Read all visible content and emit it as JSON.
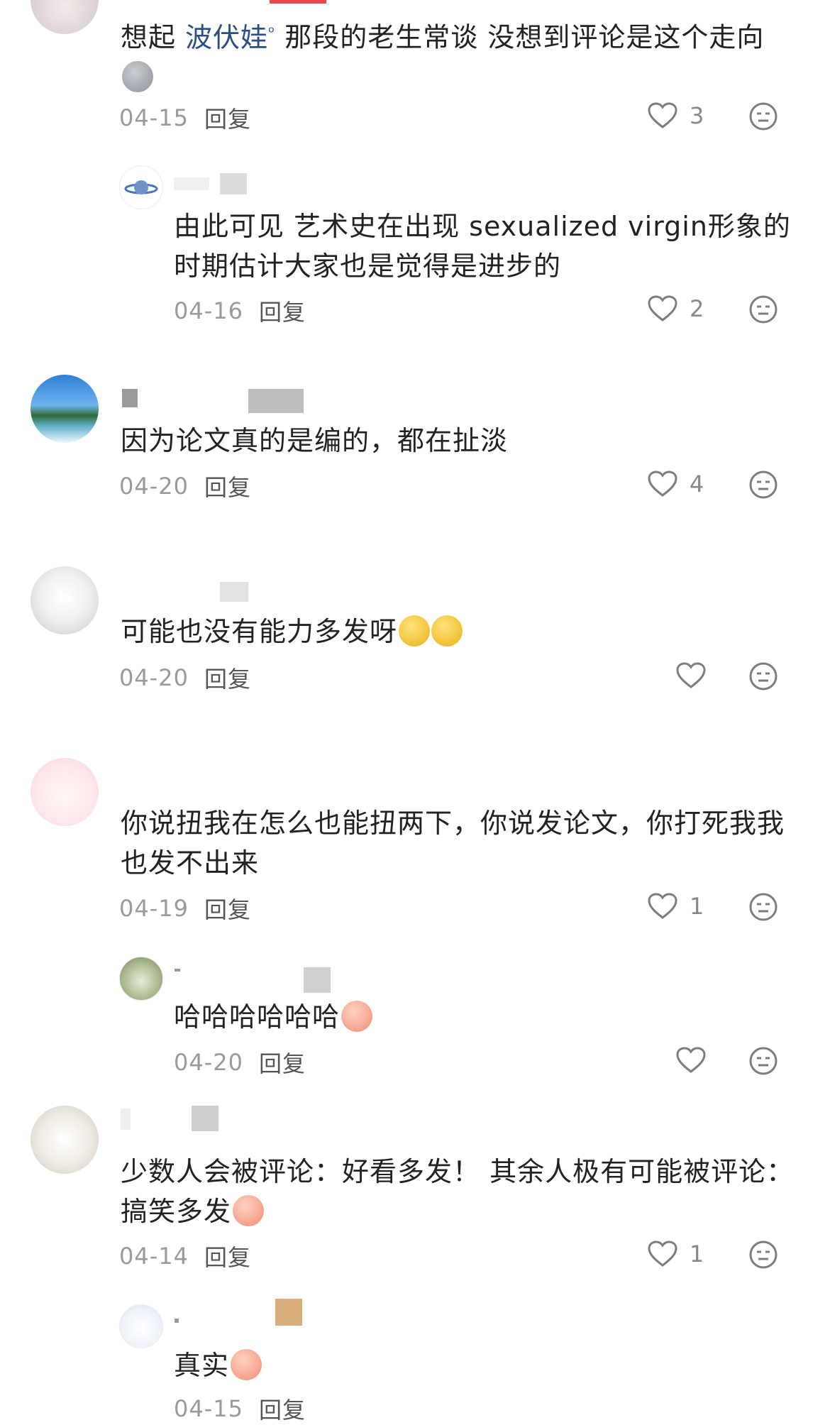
{
  "comments": [
    {
      "text_before": "想起 ",
      "mention": "波伏娃",
      "text_after": " 那段的老生常谈 没想到评论是这个走向",
      "date": "04-15",
      "reply_label": "回复",
      "likes": "3"
    },
    {
      "text": "由此可见 艺术史在出现 sexualized virgin形象的时期估计大家也是觉得是进步的",
      "date": "04-16",
      "reply_label": "回复",
      "likes": "2"
    },
    {
      "text": "因为论文真的是编的，都在扯淡",
      "date": "04-20",
      "reply_label": "回复",
      "likes": "4"
    },
    {
      "text": "可能也没有能力多发呀",
      "date": "04-20",
      "reply_label": "回复",
      "likes": ""
    },
    {
      "text": "你说扭我在怎么也能扭两下，你说发论文，你打死我我也发不出来",
      "date": "04-19",
      "reply_label": "回复",
      "likes": "1"
    },
    {
      "text": "哈哈哈哈哈哈",
      "date": "04-20",
      "reply_label": "回复",
      "likes": ""
    },
    {
      "text": "少数人会被评论：好看多发！ 其余人极有可能被评论：搞笑多发",
      "date": "04-14",
      "reply_label": "回复",
      "likes": "1"
    },
    {
      "text": "真实",
      "date": "04-15",
      "reply_label": "回复",
      "likes": ""
    }
  ],
  "colors": {
    "mention": "#2a4f86",
    "meta": "#9a9a9a",
    "text": "#222222"
  },
  "icons": [
    "heart-icon",
    "emoji-react-icon"
  ]
}
